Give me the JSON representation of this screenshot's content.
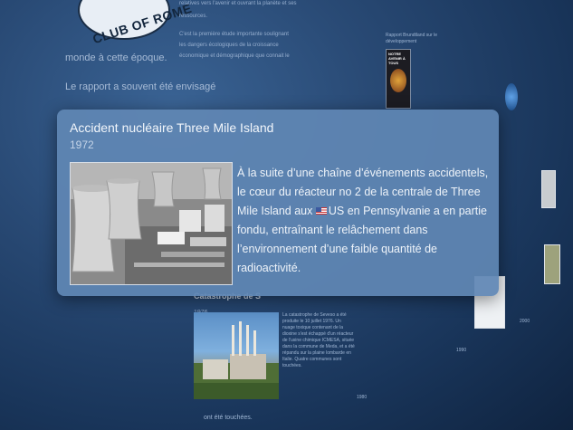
{
  "background": {
    "logo_text": "CLUB OF ROME",
    "left_line_1": "monde à cette époque.",
    "left_line_2": "Le rapport a souvent été envisagé",
    "col_lines": [
      "ressources.",
      "C'est la première étude importante soulignant",
      "les dangers écologiques de la croissance",
      "économique et démographique que connait le"
    ],
    "top_right_small": "relatives vers l'avenir et ouvrant la planète et ses",
    "book_title": "NOTRE AVENIR À TOUS",
    "book_heading": "Rapport Brundtland sur le développement"
  },
  "lower_card": {
    "title": "Catastrophe de S",
    "year": "1976",
    "body": "La catastrophe de Seveso a été produite le 10 juillet 1976. Un nuage toxique contenant de la dioxine s'est échappé d'un réacteur de l'usine chimique ICMESA, située dans la commune de Meda, et a été répandu sur la plaine lombarde en Italie. Quatre communes sont touchées.",
    "footer": "ont été touchées."
  },
  "timeline": {
    "years": [
      "1980",
      "1990",
      "2000"
    ]
  },
  "main_card": {
    "title": "Accident nucléaire Three Mile Island",
    "year": "1972",
    "body_before_flag": "À la suite d’une chaîne d’événements accidentels, le cœur du réacteur no 2 de la centrale de Three Mile Island aux ",
    "flag_icon": "us-flag-icon",
    "body_after_flag": "US en Pennsylvanie a en partie fondu, entraînant le relâchement dans l’environnement d’une faible quantité de radioactivité."
  }
}
